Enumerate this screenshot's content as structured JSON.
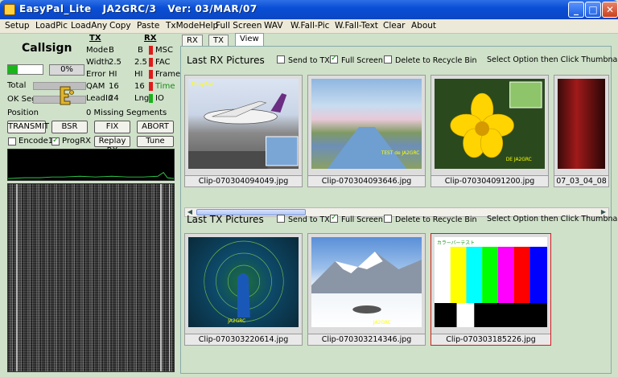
{
  "window": {
    "title": "EasyPal_Lite   JA2GRC/3   Ver: 03/MAR/07"
  },
  "menu": [
    "Setup",
    "LoadPic",
    "LoadAny",
    "Copy",
    "Paste",
    "TxModeHelp",
    "Full Screen",
    "WAV",
    "W.Fall-Pic",
    "W.Fall-Text",
    "Clear",
    "About"
  ],
  "left": {
    "callsign": "Callsign",
    "progress_percent": "0%",
    "progress_fraction": 0.28,
    "total_label": "Total",
    "ok_segs_label": "OK Segs",
    "position_label": "Position",
    "missing_segments": "0 Missing Segments",
    "tx_header": "TX",
    "rx_header": "RX",
    "rows": [
      {
        "name": "Mode",
        "tx": "B",
        "rx": "B",
        "status": "MSC",
        "color": "red"
      },
      {
        "name": "Width",
        "tx": "2.5",
        "rx": "2.5",
        "status": "FAC",
        "color": "red"
      },
      {
        "name": "Error",
        "tx": "HI",
        "rx": "HI",
        "status": "Frame",
        "color": "red"
      },
      {
        "name": "QAM",
        "tx": "16",
        "rx": "16",
        "status": "Time",
        "color": "green"
      },
      {
        "name": "LeadIn",
        "tx": "24",
        "rx": "Lng",
        "status": "IO",
        "color": "green"
      }
    ],
    "buttons": {
      "transmit": "TRANSMIT",
      "bsr": "BSR",
      "fix": "FIX",
      "abort": "ABORT",
      "replay": "Replay RX",
      "tune": "Tune"
    },
    "checks": {
      "encode": "Encode1",
      "progrx": "ProgRX"
    },
    "colors": {
      "red": "#e01b1b",
      "green": "#1cb01c"
    }
  },
  "tabs": [
    "RX",
    "TX",
    "View"
  ],
  "rx_section": {
    "title": "Last RX Pictures",
    "send_to_tx": "Send to TX",
    "full_screen": "Full Screen",
    "delete": "Delete to Recycle Bin",
    "hint": "Select Option then Click Thumbnail",
    "thumbs": [
      "Clip-070304094049.jpg",
      "Clip-070304093646.jpg",
      "Clip-070304091200.jpg",
      "07_03_04_08"
    ]
  },
  "tx_section": {
    "title": "Last TX Pictures",
    "send_to_tx": "Send to TX",
    "full_screen": "Full Screen",
    "delete": "Delete to Recycle Bin",
    "hint": "Select Option then Click Thumbnail",
    "thumbs": [
      "Clip-070303220614.jpg",
      "Clip-070303214346.jpg",
      "Clip-070303185226.jpg"
    ]
  }
}
